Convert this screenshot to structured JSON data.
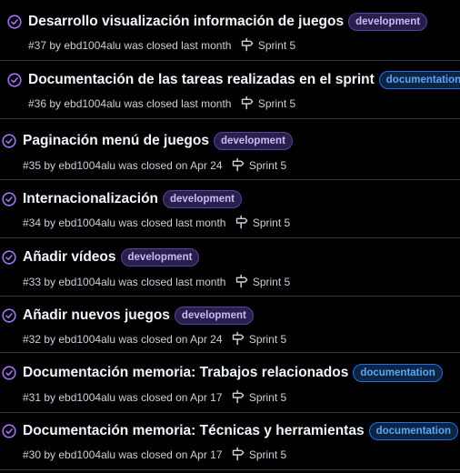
{
  "colors": {
    "closed_icon": "#a371f7",
    "development_label": "#c9b8ff",
    "documentation_label": "#58a6ff",
    "divider": "#30363d"
  },
  "icons": {
    "status": "check-circle-icon",
    "milestone": "milestone-signpost-icon"
  },
  "issues": [
    {
      "title": "Desarrollo visualización información de juegos",
      "label": "development",
      "meta": "#37 by ebd1004alu was closed last month",
      "milestone": "Sprint 5"
    },
    {
      "title": "Documentación de las tareas realizadas en el sprint",
      "label": "documentation",
      "meta": "#36 by ebd1004alu was closed last month",
      "milestone": "Sprint 5"
    },
    {
      "title": "Paginación menú de juegos",
      "label": "development",
      "meta": "#35 by ebd1004alu was closed on Apr 24",
      "milestone": "Sprint 5"
    },
    {
      "title": "Internacionalización",
      "label": "development",
      "meta": "#34 by ebd1004alu was closed last month",
      "milestone": "Sprint 5"
    },
    {
      "title": "Añadir vídeos",
      "label": "development",
      "meta": "#33 by ebd1004alu was closed last month",
      "milestone": "Sprint 5"
    },
    {
      "title": "Añadir nuevos juegos",
      "label": "development",
      "meta": "#32 by ebd1004alu was closed on Apr 24",
      "milestone": "Sprint 5"
    },
    {
      "title": "Documentación memoria: Trabajos relacionados",
      "label": "documentation",
      "meta": "#31 by ebd1004alu was closed on Apr 17",
      "milestone": "Sprint 5"
    },
    {
      "title": "Documentación memoria: Técnicas y herramientas",
      "label": "documentation",
      "meta": "#30 by ebd1004alu was closed on Apr 17",
      "milestone": "Sprint 5"
    }
  ]
}
